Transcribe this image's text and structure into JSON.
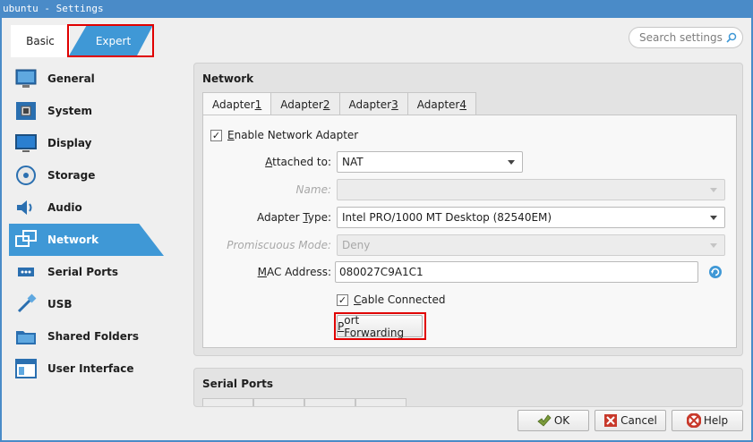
{
  "window": {
    "title": "ubuntu - Settings"
  },
  "mode_switch": {
    "basic_label": "Basic",
    "expert_label": "Expert",
    "active": "Expert"
  },
  "search": {
    "placeholder": "Search settings"
  },
  "sidebar": {
    "items": [
      {
        "label": "General",
        "icon": "general-icon"
      },
      {
        "label": "System",
        "icon": "system-icon"
      },
      {
        "label": "Display",
        "icon": "display-icon"
      },
      {
        "label": "Storage",
        "icon": "storage-icon"
      },
      {
        "label": "Audio",
        "icon": "audio-icon"
      },
      {
        "label": "Network",
        "icon": "network-icon",
        "active": true
      },
      {
        "label": "Serial Ports",
        "icon": "serial-ports-icon"
      },
      {
        "label": "USB",
        "icon": "usb-icon"
      },
      {
        "label": "Shared Folders",
        "icon": "shared-folders-icon"
      },
      {
        "label": "User Interface",
        "icon": "user-interface-icon"
      }
    ]
  },
  "network": {
    "title": "Network",
    "tabs": [
      {
        "label": "Adapter ",
        "key": "1"
      },
      {
        "label": "Adapter ",
        "key": "2"
      },
      {
        "label": "Adapter ",
        "key": "3"
      },
      {
        "label": "Adapter ",
        "key": "4"
      }
    ],
    "enable_adapter": {
      "label_key": "E",
      "label_rest": "nable Network Adapter",
      "checked": true
    },
    "attached_to": {
      "label_key": "A",
      "label_rest": "ttached to:",
      "value": "NAT"
    },
    "name": {
      "label": "Name:",
      "value": ""
    },
    "adapter_type": {
      "label_pre": "Adapter ",
      "label_key": "T",
      "label_rest": "ype:",
      "value": "Intel PRO/1000 MT Desktop (82540EM)"
    },
    "promiscuous": {
      "label": "Promiscuous Mode:",
      "value": "Deny"
    },
    "mac": {
      "label_key": "M",
      "label_rest": "AC Address:",
      "value": "080027C9A1C1"
    },
    "cable": {
      "label_key": "C",
      "label_rest": "able Connected",
      "checked": true
    },
    "port_forwarding": {
      "label_key": "P",
      "label_rest": "ort Forwarding"
    }
  },
  "serial": {
    "title": "Serial Ports"
  },
  "footer": {
    "ok": "OK",
    "cancel": "Cancel",
    "help": "Help"
  },
  "colors": {
    "accent": "#3f98d6",
    "highlight": "#e00000",
    "titlebar": "#4a8bc8"
  }
}
